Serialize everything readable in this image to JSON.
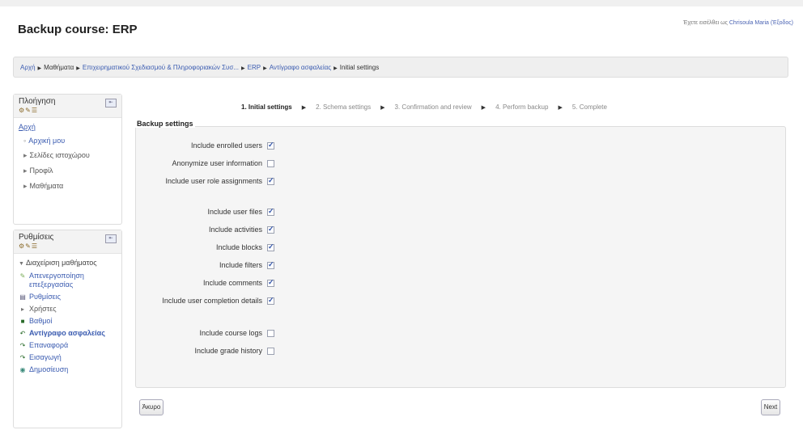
{
  "page_title": "Backup course: ERP",
  "login": {
    "prefix": "Έχετε εισέλθει ως",
    "user": "Chrisoula Maria (Έξοδος)"
  },
  "breadcrumb": [
    {
      "label": "Αρχή",
      "link": true
    },
    {
      "label": "Μαθήματα",
      "link": false
    },
    {
      "label": "Επιχειρηματικού Σχεδιασμού & Πληροφοριακών Συσ...",
      "link": true
    },
    {
      "label": "ERP",
      "link": true
    },
    {
      "label": "Αντίγραφο ασφαλείας",
      "link": true
    },
    {
      "label": "Initial settings",
      "link": false
    }
  ],
  "navigation_block": {
    "title": "Πλοήγηση",
    "icons": "⚙✎☰",
    "home": "Αρχή",
    "items": [
      "Αρχική μου",
      "Σελίδες ιστοχώρου",
      "Προφίλ",
      "Μαθήματα"
    ]
  },
  "settings_block": {
    "title": "Ρυθμίσεις",
    "icons": "⚙✎☰",
    "section": "Διαχείριση μαθήματος",
    "items": [
      {
        "label": "Απενεργοποίηση επεξεργασίας",
        "icon": "pencil-icon",
        "style": "link"
      },
      {
        "label": "Ρυθμίσεις",
        "icon": "document-icon",
        "style": "link"
      },
      {
        "label": "Χρήστες",
        "icon": "expand-arrow-icon",
        "style": "plain"
      },
      {
        "label": "Βαθμοί",
        "icon": "grades-icon",
        "style": "link"
      },
      {
        "label": "Αντίγραφο ασφαλείας",
        "icon": "backup-icon",
        "style": "bold"
      },
      {
        "label": "Επαναφορά",
        "icon": "restore-icon",
        "style": "link"
      },
      {
        "label": "Εισαγωγή",
        "icon": "import-icon",
        "style": "link"
      },
      {
        "label": "Δημοσίευση",
        "icon": "publish-icon",
        "style": "link"
      }
    ]
  },
  "steps": [
    {
      "label": "1. Initial settings",
      "active": true
    },
    {
      "label": "2. Schema settings",
      "active": false
    },
    {
      "label": "3. Confirmation and review",
      "active": false
    },
    {
      "label": "4. Perform backup",
      "active": false
    },
    {
      "label": "5. Complete",
      "active": false
    }
  ],
  "legend": "Backup settings",
  "settings": [
    {
      "label": "Include enrolled users",
      "checked": true
    },
    {
      "label": "Anonymize user information",
      "checked": false
    },
    {
      "label": "Include user role assignments",
      "checked": true
    },
    {
      "label": "Include user files",
      "checked": true
    },
    {
      "label": "Include activities",
      "checked": true
    },
    {
      "label": "Include blocks",
      "checked": true
    },
    {
      "label": "Include filters",
      "checked": true
    },
    {
      "label": "Include comments",
      "checked": true
    },
    {
      "label": "Include user completion details",
      "checked": true
    },
    {
      "label": "Include course logs",
      "checked": false
    },
    {
      "label": "Include grade history",
      "checked": false
    }
  ],
  "buttons": {
    "cancel": "Άκυρο",
    "next": "Next"
  },
  "colors": {
    "link": "#3a5bb0",
    "panel": "#f5f5f5"
  }
}
